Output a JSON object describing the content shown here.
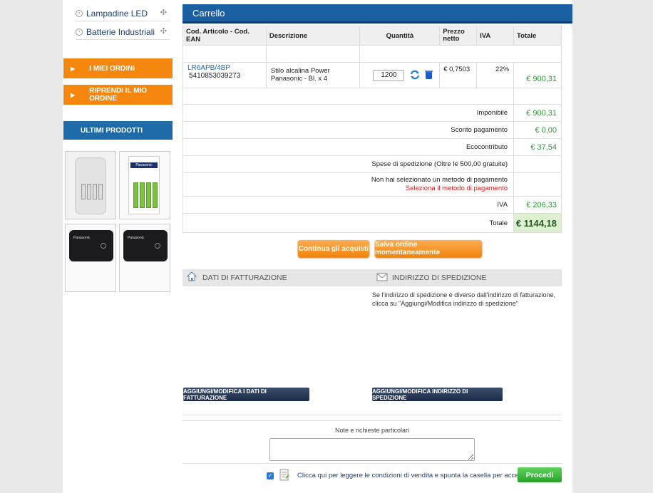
{
  "sidebar": {
    "categories": [
      {
        "label": "Lampadine LED"
      },
      {
        "label": "Batterie Industriali"
      }
    ],
    "my_orders_label": "I MIEI ORDINI",
    "resume_order_label": "RIPRENDI IL MIO ORDINE",
    "recent_products_label": "ULTIMI PRODOTTI",
    "pack_brand": "Panasonic",
    "powerbank_brand": "Panasonic"
  },
  "cart": {
    "title": "Carrello",
    "headers": {
      "code": "Cod. Articolo - Cod. EAN",
      "description": "Descrizione",
      "quantity": "Quantità",
      "net_price": "Prezzo netto",
      "vat": "IVA",
      "total": "Totale"
    },
    "item": {
      "code": "LR6APB/4BP",
      "ean": "5410853039273",
      "description": "Stilo alcalina Power Panasonic - Bl. x 4",
      "quantity": "1200",
      "net_price": "€ 0,7503",
      "vat": "22%",
      "total": "€ 900,31"
    },
    "summary": {
      "taxable_label": "Imponibile",
      "taxable_value": "€ 900,31",
      "payment_discount_label": "Sconto pagamento",
      "payment_discount_value": "€ 0,00",
      "eco_label": "Ecocontributo",
      "eco_value": "€ 37,54",
      "shipping_label": "Spese di spedizione (Oltre le 500,00 gratuite)",
      "shipping_value": "",
      "payment_method_note": "Non hai selezionato un metodo di pagamento",
      "payment_method_link": "Seleziona il metodo di pagamento",
      "vat_label": "IVA",
      "vat_value": "€ 206,33",
      "total_label": "Totale",
      "total_value": "€ 1144,18"
    },
    "continue_label": "Continua gli acquisti",
    "save_label": "Salva ordine momentaneamente"
  },
  "billing": {
    "label": "DATI DI FATTURAZIONE",
    "button_label": "AGGIUNGI/MODIFICA I DATI DI FATTURAZIONE"
  },
  "shipping": {
    "label": "INDIRIZZO DI SPEDIZIONE",
    "note": "Se l'indirizzo di spedizione è diverso dall'indirizzo di fatturazione, clicca su \"Aggiungi/Modifica indirizzo di spedizione\"",
    "button_label": "AGGIUNGI/MODIFICA INDIRIZZO DI SPEDIZIONE"
  },
  "notes": {
    "label": "Note e richieste particolari",
    "value": ""
  },
  "terms": {
    "text": "Clicca qui per leggere le condizioni di vendita e spunta la casella per accettarle.",
    "checked": "✓"
  },
  "proceed_label": "Procedi",
  "colors": {
    "accent_blue": "#1b5fa3",
    "orange": "#f5870f",
    "green_value": "#2c9a35",
    "link_red": "#e02020"
  }
}
